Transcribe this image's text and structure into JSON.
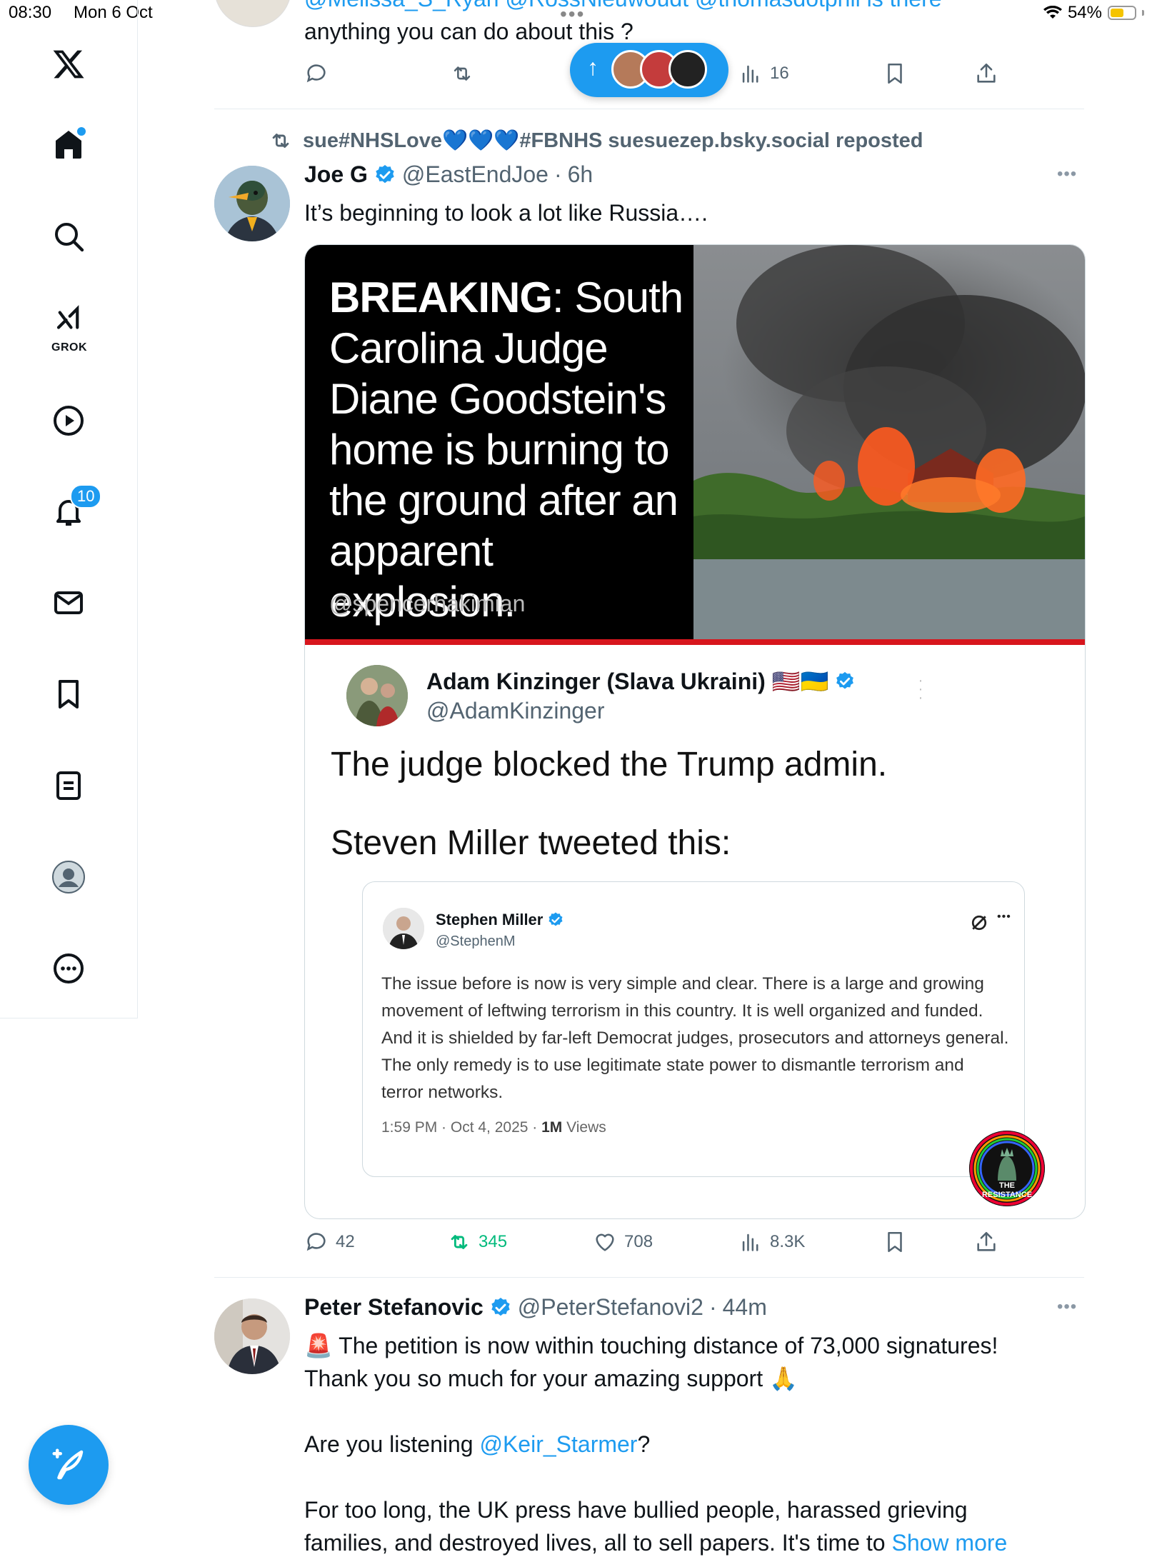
{
  "status_bar": {
    "time": "08:30",
    "date": "Mon 6 Oct",
    "battery": "54%"
  },
  "sidebar": {
    "grok_label": "GROK",
    "notifications_badge": "10"
  },
  "prev_tweet": {
    "mentions_line": "@Melissa_S_Ryan @RossNieuwoudt @thomasdotphil is there",
    "text": "anything you can do about this ?",
    "views": "16"
  },
  "new_posts_pill": {
    "arrow": "↑"
  },
  "repost": {
    "by": "sue#NHSLove💙💙💙#FBNHS suesuezep.bsky.social reposted",
    "author_name": "Joe G",
    "author_handle": "@EastEndJoe",
    "sep": "·",
    "time": "6h",
    "text": "It’s beginning to look a lot like Russia….",
    "image_headline_bold": "BREAKING",
    "image_headline_rest": ": South Carolina Judge Diane Goodstein's home is burning to the ground after an apparent explosion.",
    "image_handle": "@spencerhakimian",
    "quoted_name": "Adam Kinzinger (Slava Ukraini) 🇺🇸🇺🇦",
    "quoted_handle": "@AdamKinzinger",
    "quoted_line1": "The judge blocked the Trump admin.",
    "quoted_line2": "Steven Miller tweeted this:",
    "inner": {
      "name": "Stephen Miller",
      "handle": "@StephenM",
      "text": "The issue before is now is very simple and clear. There is a large and growing movement of leftwing terrorism in this country. It is well organized and funded. And it is shielded by far-left Democrat judges, prosecutors and attorneys general. The only remedy is to use legitimate state power to dismantle terrorism and terror networks.",
      "meta_time": "1:59 PM · Oct 4, 2025 · ",
      "meta_views_num": "1M",
      "meta_views_label": " Views",
      "badge_line1": "THE",
      "badge_line2": "RESISTANCE"
    },
    "replies": "42",
    "reposts": "345",
    "likes": "708",
    "views": "8.3K"
  },
  "next_tweet": {
    "author_name": "Peter Stefanovic",
    "author_handle": "@PeterStefanovi2",
    "sep": "·",
    "time": "44m",
    "line1": "🚨 The petition is now within touching distance of 73,000 signatures!",
    "line2": "Thank you so much for your amazing support 🙏",
    "line3_pre": "Are you listening ",
    "line3_link": "@Keir_Starmer",
    "line3_post": "?",
    "line4": "For too long, the UK press have bullied people, harassed grieving",
    "line5_pre": "families, and destroyed lives, all to sell papers. It's time to ",
    "line5_link": "Show more"
  },
  "colors": {
    "accent": "#1d9bf0",
    "repost_green": "#00ba7c",
    "text": "#0f1419",
    "muted": "#536471"
  }
}
